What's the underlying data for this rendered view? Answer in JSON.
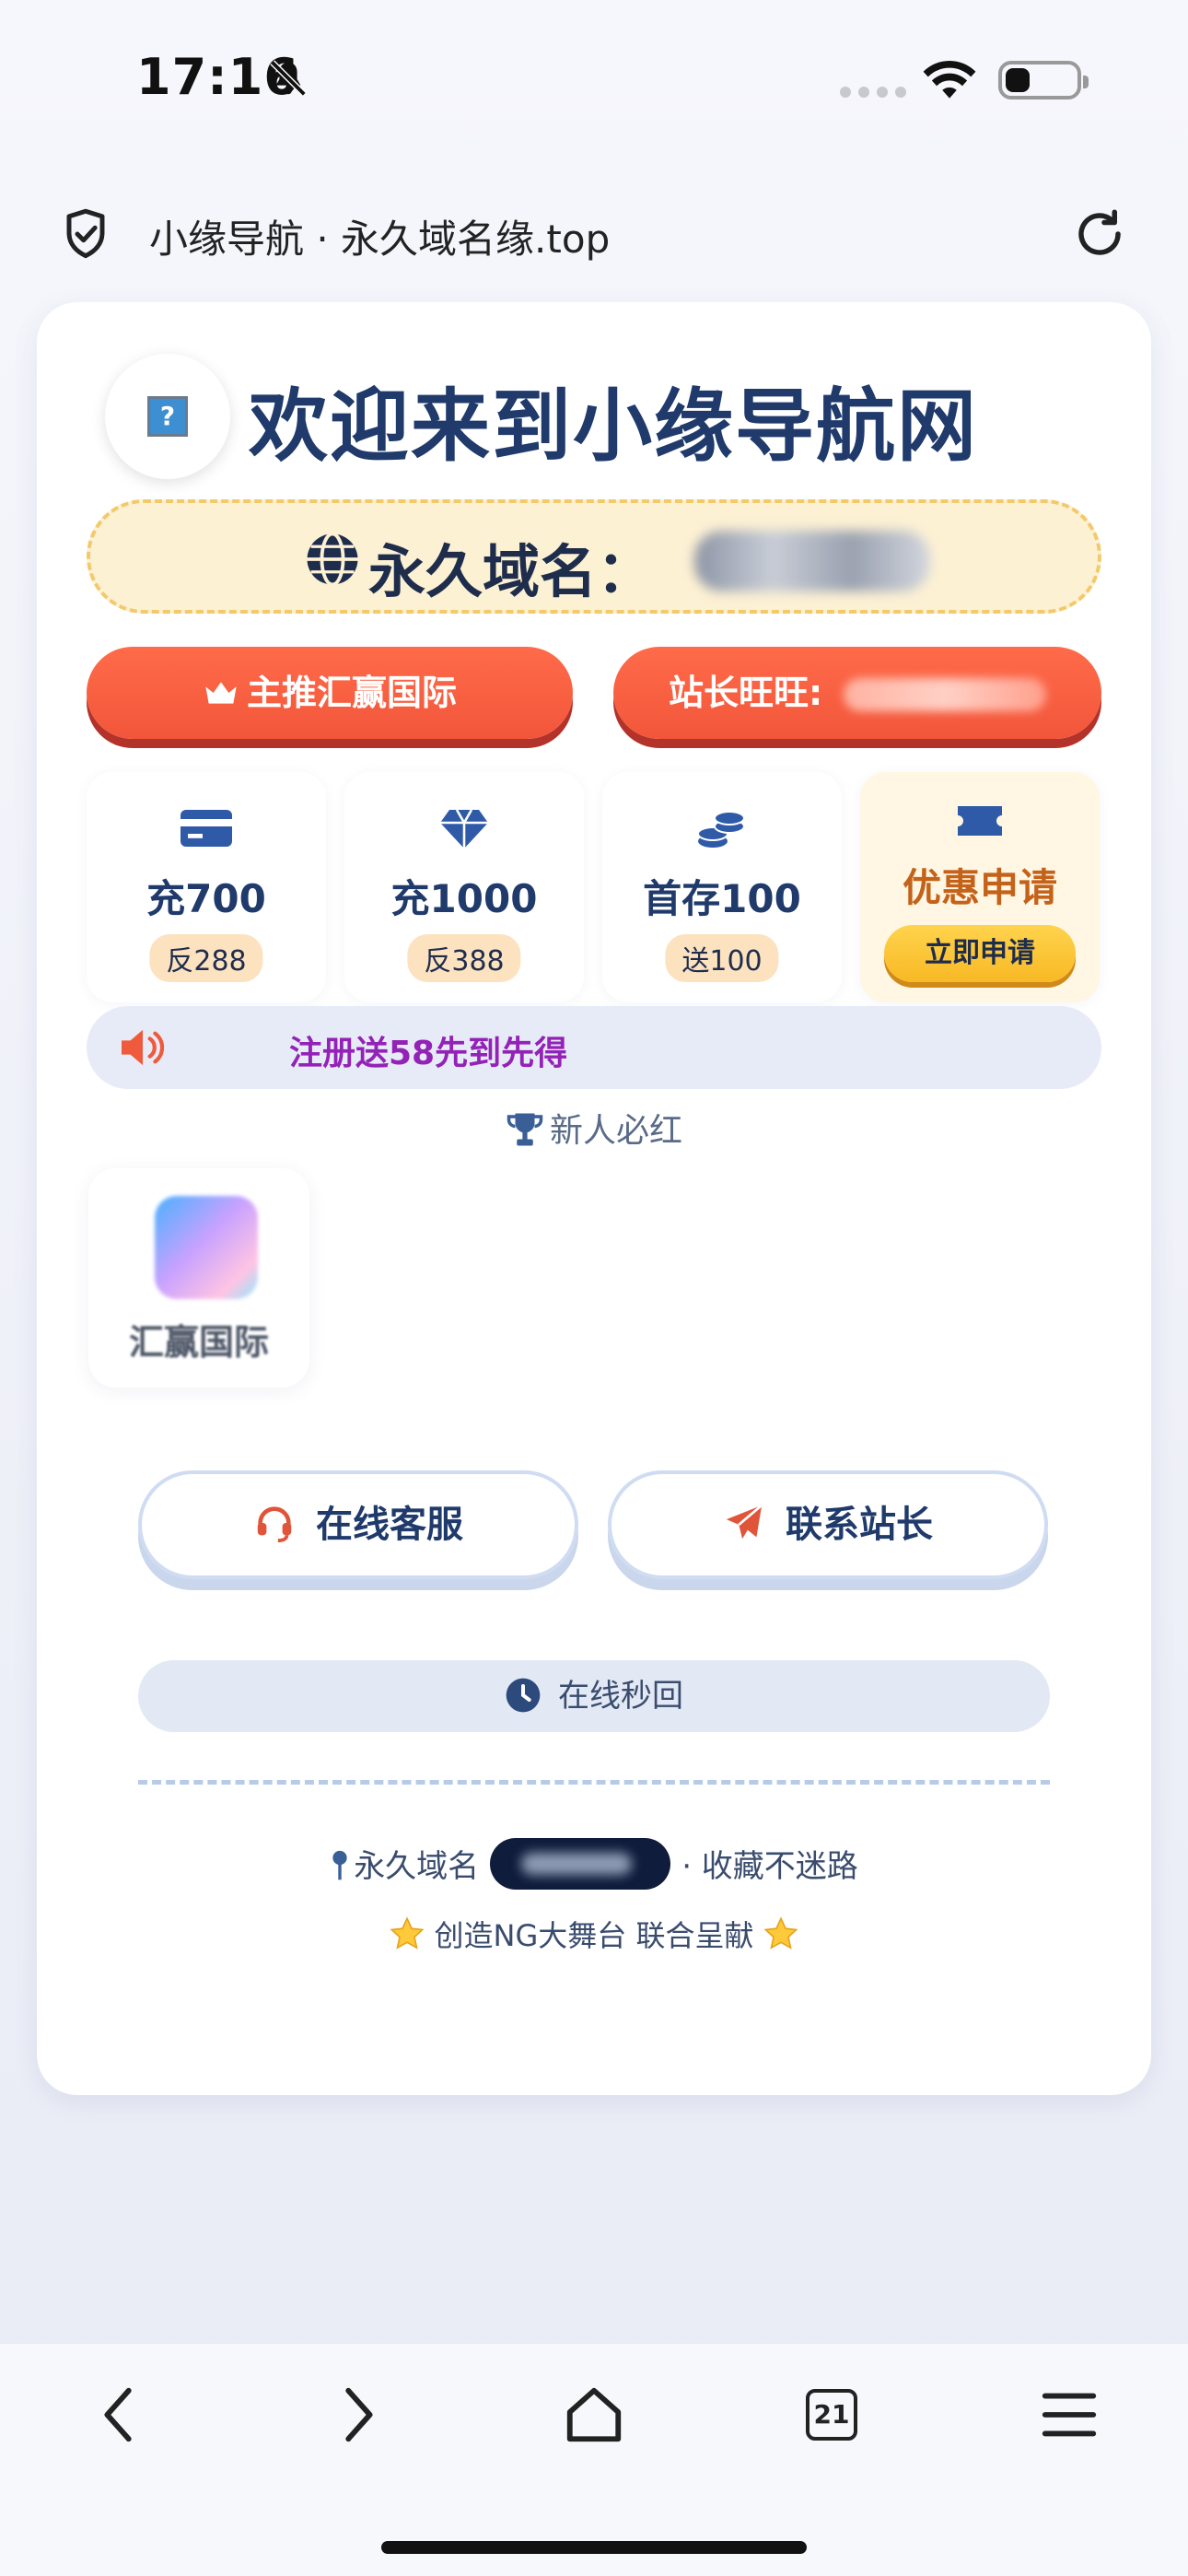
{
  "status": {
    "time": "17:16",
    "battery_level": 0.3
  },
  "browser": {
    "title": "小缘导航 · 永久域名缘.top",
    "tab_count": "21"
  },
  "header": {
    "welcome": "欢迎来到小缘导航网",
    "domain_label": "永久域名："
  },
  "buttons": {
    "main_promo": "主推汇赢国际",
    "owner_label": "站长旺旺:"
  },
  "promos": [
    {
      "title": "充700",
      "tag": "反288",
      "icon": "card-icon"
    },
    {
      "title": "充1000",
      "tag": "反388",
      "icon": "diamond-icon"
    },
    {
      "title": "首存100",
      "tag": "送100",
      "icon": "coins-icon"
    },
    {
      "title": "优惠申请",
      "action": "立即申请",
      "icon": "ticket-icon"
    }
  ],
  "marquee": {
    "text": "注册送58先到先得"
  },
  "section": {
    "newbie": "新人必红"
  },
  "apps": [
    {
      "label": "汇赢国际"
    }
  ],
  "contact": {
    "service": "在线客服",
    "owner": "联系站长",
    "online": "在线秒回"
  },
  "footer": {
    "domain_prefix": "永久域名",
    "domain_suffix": "· 收藏不迷路",
    "tagline": "创造NG大舞台 联合呈献"
  },
  "colors": {
    "accent_red": "#f2563a",
    "title_blue": "#1f3a6b",
    "marquee_purple": "#9322b6",
    "gold": "#f8b925"
  }
}
